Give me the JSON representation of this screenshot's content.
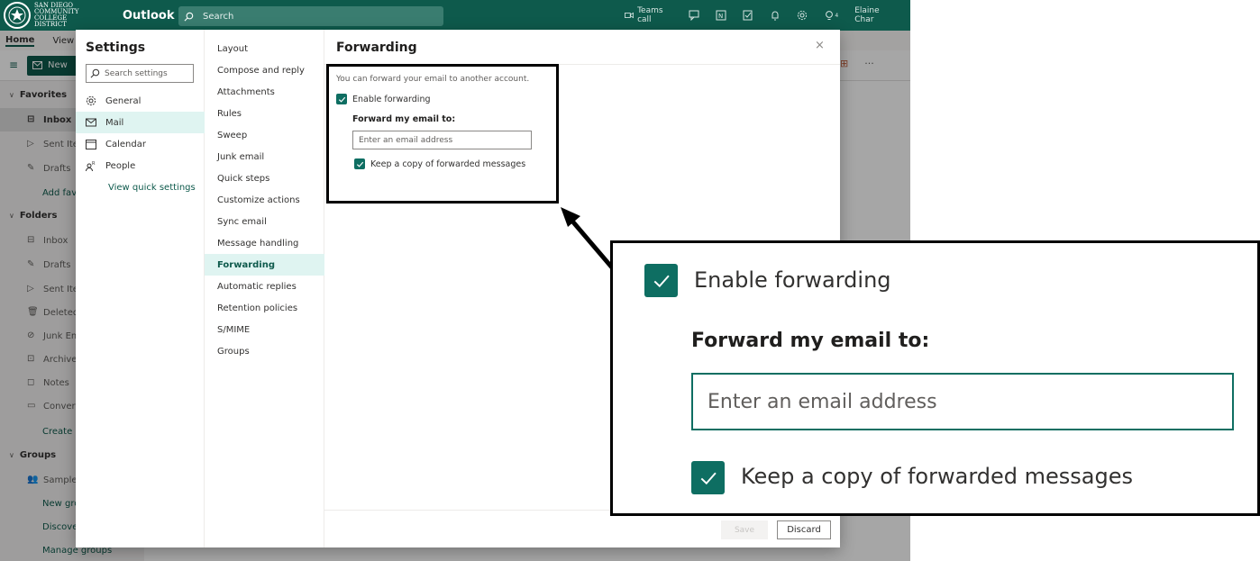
{
  "topbar": {
    "org_line1": "SAN DIEGO",
    "org_line2": "COMMUNITY COLLEGE",
    "org_line3": "DISTRICT",
    "app_title": "Outlook",
    "search_placeholder": "Search",
    "teams_call": "Teams call",
    "user_name": "Elaine Char",
    "notif_count": "4"
  },
  "ribbon": {
    "tab_home": "Home",
    "tab_view": "View",
    "new_label": "New",
    "more": "···"
  },
  "leftnav": {
    "favorites": "Favorites",
    "fav_inbox": "Inbox",
    "fav_sent": "Sent Iten",
    "fav_drafts": "Drafts",
    "fav_add": "Add favo",
    "folders": "Folders",
    "f_inbox": "Inbox",
    "f_drafts": "Drafts",
    "f_sent": "Sent Iten",
    "f_deleted": "Deleted",
    "f_junk": "Junk Ema",
    "f_archive": "Archive",
    "f_notes": "Notes",
    "f_convers": "Convers",
    "f_create": "Create n",
    "groups": "Groups",
    "g_sample": "Sample I",
    "g_new": "New gro",
    "g_discover": "Discover",
    "g_manage": "Manage groups"
  },
  "settings": {
    "title": "Settings",
    "search_placeholder": "Search settings",
    "cat_general": "General",
    "cat_mail": "Mail",
    "cat_calendar": "Calendar",
    "cat_people": "People",
    "view_quick": "View quick settings"
  },
  "mail_sub": {
    "layout": "Layout",
    "compose": "Compose and reply",
    "attachments": "Attachments",
    "rules": "Rules",
    "sweep": "Sweep",
    "junk": "Junk email",
    "quick_steps": "Quick steps",
    "customize": "Customize actions",
    "sync": "Sync email",
    "message_handling": "Message handling",
    "forwarding": "Forwarding",
    "auto_replies": "Automatic replies",
    "retention": "Retention policies",
    "smime": "S/MIME",
    "groups": "Groups"
  },
  "forwarding": {
    "title": "Forwarding",
    "close": "×",
    "intro": "You can forward your email to another account.",
    "enable_label": "Enable forwarding",
    "enable_checked": true,
    "forward_to_label": "Forward my email to:",
    "email_placeholder": "Enter an email address",
    "keep_copy_label": "Keep a copy of forwarded messages",
    "keep_copy_checked": true,
    "save": "Save",
    "discard": "Discard"
  },
  "colors": {
    "brand": "#0e5a4c",
    "accent": "#0e6e62",
    "selected_bg": "#dff4f1"
  }
}
